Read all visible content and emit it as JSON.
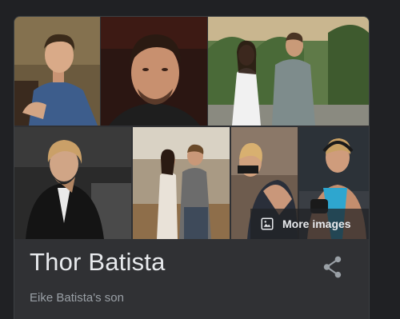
{
  "knowledge_panel": {
    "images": [
      {
        "name": "thor-batista-photo-1",
        "palette": [
          "#5a4a3a",
          "#3b5b8a",
          "#d6a988"
        ]
      },
      {
        "name": "thor-batista-photo-2",
        "palette": [
          "#3a1e18",
          "#2a2a2a",
          "#c99376"
        ]
      },
      {
        "name": "thor-batista-photo-3",
        "palette": [
          "#4e6a3a",
          "#f1f1f1",
          "#7c8a8a"
        ]
      },
      {
        "name": "thor-batista-photo-4",
        "palette": [
          "#1a1a1a",
          "#151515",
          "#d2a78a"
        ]
      },
      {
        "name": "thor-batista-photo-5",
        "palette": [
          "#8f7a5c",
          "#6a6a6a",
          "#c9b8a2"
        ]
      },
      {
        "name": "thor-batista-photo-6",
        "palette": [
          "#7f6a5a",
          "#2a2f3a",
          "#c99a7a"
        ]
      },
      {
        "name": "thor-batista-photo-7",
        "palette": [
          "#2a3036",
          "#35a3c9",
          "#c48e6e"
        ]
      }
    ],
    "more_images_label": "More images",
    "title": "Thor Batista",
    "subtitle": "Eike Batista's son"
  },
  "colors": {
    "page_background": "#202124",
    "panel_background": "#303134",
    "title_text": "#e8eaed",
    "subtitle_text": "#9aa0a6",
    "icon": "#9aa0a6"
  }
}
